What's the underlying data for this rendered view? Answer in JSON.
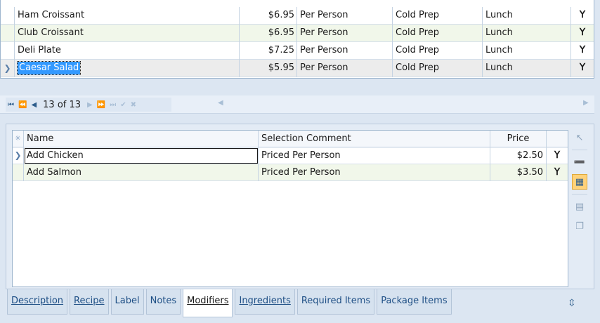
{
  "top_grid": {
    "rows": [
      {
        "name": "Ham Croissant",
        "price": "$6.95",
        "unit": "Per Person",
        "category": "Cold Prep",
        "meal": "Lunch",
        "icon": "fork-knife-icon"
      },
      {
        "name": "Club Croissant",
        "price": "$6.95",
        "unit": "Per Person",
        "category": "Cold Prep",
        "meal": "Lunch",
        "icon": "fork-knife-icon"
      },
      {
        "name": "Deli Plate",
        "price": "$7.25",
        "unit": "Per Person",
        "category": "Cold Prep",
        "meal": "Lunch",
        "icon": "fork-knife-icon"
      },
      {
        "name": "Caesar Salad",
        "price": "$5.95",
        "unit": "Per Person",
        "category": "Cold Prep",
        "meal": "Lunch",
        "icon": "fork-knife-icon"
      }
    ],
    "selected_index": 3
  },
  "navigator": {
    "position": "13 of 13"
  },
  "modifiers_grid": {
    "headers": {
      "name": "Name",
      "comment": "Selection Comment",
      "price": "Price"
    },
    "rows": [
      {
        "name": "Add Chicken",
        "comment": "Priced Per Person",
        "price": "$2.50",
        "icon": "fork-knife-icon"
      },
      {
        "name": "Add Salmon",
        "comment": "Priced Per Person",
        "price": "$3.50",
        "icon": "fork-knife-icon"
      }
    ]
  },
  "tabs": [
    {
      "label": "Description",
      "state": "link"
    },
    {
      "label": "Recipe",
      "state": "link"
    },
    {
      "label": "Label",
      "state": "plain"
    },
    {
      "label": "Notes",
      "state": "plain"
    },
    {
      "label": "Modifiers",
      "state": "active"
    },
    {
      "label": "Ingredients",
      "state": "link"
    },
    {
      "label": "Required Items",
      "state": "plain"
    },
    {
      "label": "Package Items",
      "state": "plain"
    }
  ],
  "colors": {
    "selection": "#3399ff",
    "alt_row": "#f1f7ea",
    "active_tool": "#ffd27a",
    "background": "#dce6f2"
  }
}
